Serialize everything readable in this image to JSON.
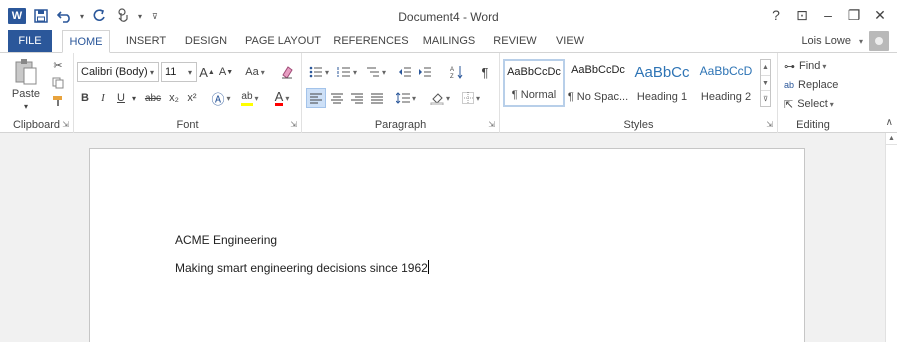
{
  "window": {
    "title": "Document4 - Word",
    "controls": {
      "help": "?",
      "ribbon_display": "⊡",
      "minimize": "–",
      "restore": "❐",
      "close": "✕"
    }
  },
  "quick_access": {
    "app_icon": "W",
    "save_icon": "save-icon",
    "undo_icon": "undo-icon",
    "redo_icon": "redo-icon",
    "touch_icon": "touch-mode-icon"
  },
  "tabs": {
    "file": "FILE",
    "items": [
      "HOME",
      "INSERT",
      "DESIGN",
      "PAGE LAYOUT",
      "REFERENCES",
      "MAILINGS",
      "REVIEW",
      "VIEW"
    ],
    "active": "HOME"
  },
  "user": {
    "name": "Lois Lowe"
  },
  "ribbon": {
    "clipboard": {
      "label": "Clipboard",
      "paste": "Paste"
    },
    "font": {
      "label": "Font",
      "font_name": "Calibri (Body)",
      "font_size": "11",
      "bold": "B",
      "italic": "I",
      "underline": "U",
      "strikethrough": "abc",
      "subscript": "x₂",
      "superscript": "x²",
      "change_case": "Aa"
    },
    "paragraph": {
      "label": "Paragraph"
    },
    "styles": {
      "label": "Styles",
      "items": [
        {
          "sample": "AaBbCcDc",
          "name": "¶ Normal"
        },
        {
          "sample": "AaBbCcDc",
          "name": "¶ No Spac..."
        },
        {
          "sample": "AaBbCc",
          "name": "Heading 1"
        },
        {
          "sample": "AaBbCcD",
          "name": "Heading 2"
        }
      ]
    },
    "editing": {
      "label": "Editing",
      "find": "Find",
      "replace": "Replace",
      "select": "Select"
    }
  },
  "document": {
    "lines": [
      "ACME Engineering",
      "Making smart engineering decisions since 1962"
    ]
  },
  "colors": {
    "accent": "#2b579a",
    "highlight": "#ffff00",
    "font_color": "#ff0000"
  }
}
